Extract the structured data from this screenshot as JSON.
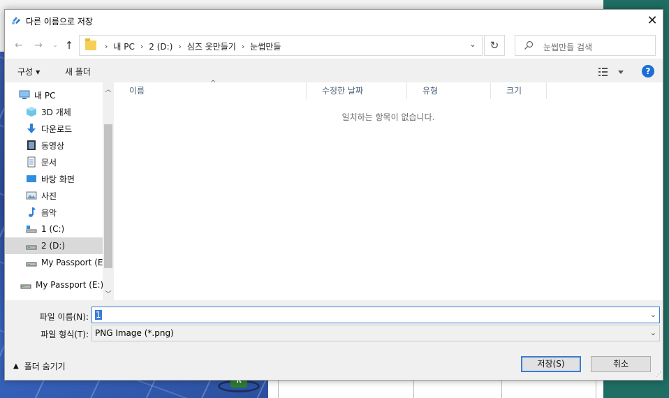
{
  "dialog": {
    "title": "다른 이름으로 저장",
    "close_label": "✕"
  },
  "address": {
    "crumbs": [
      "내 PC",
      "2 (D:)",
      "심즈 옷만들기",
      "눈썹만들"
    ]
  },
  "search": {
    "placeholder": "눈썹만들 검색"
  },
  "toolbar": {
    "organize_label": "구성",
    "new_folder_label": "새 폴더",
    "help_label": "?"
  },
  "nav_pane": {
    "items": [
      {
        "label": "내 PC",
        "icon": "pc-icon"
      },
      {
        "label": "3D 개체",
        "icon": "cube-icon"
      },
      {
        "label": "다운로드",
        "icon": "download-icon"
      },
      {
        "label": "동영상",
        "icon": "video-icon"
      },
      {
        "label": "문서",
        "icon": "document-icon"
      },
      {
        "label": "바탕 화면",
        "icon": "desktop-icon"
      },
      {
        "label": "사진",
        "icon": "picture-icon"
      },
      {
        "label": "음악",
        "icon": "music-icon"
      },
      {
        "label": "1 (C:)",
        "icon": "drive-c-icon"
      },
      {
        "label": "2 (D:)",
        "icon": "drive-icon",
        "selected": true
      },
      {
        "label": "My Passport (E:)",
        "icon": "drive-icon"
      },
      {
        "label": "My Passport (E:)",
        "icon": "drive-icon"
      }
    ]
  },
  "file_list": {
    "columns": [
      "이름",
      "수정한 날짜",
      "유형",
      "크기"
    ],
    "empty_message": "일치하는 항목이 없습니다."
  },
  "form": {
    "filename_label": "파일 이름(N):",
    "filename_value": "1",
    "filetype_label": "파일 형식(T):",
    "filetype_value": "PNG Image (*.png)"
  },
  "footer": {
    "hide_folders_label": "폴더 숨기기",
    "save_label": "저장(S)",
    "cancel_label": "취소"
  },
  "background": {
    "map_badge": "R"
  },
  "colors": {
    "accent": "#3a7bd5",
    "help": "#1c6ed6",
    "selection": "#d9d9d9"
  }
}
